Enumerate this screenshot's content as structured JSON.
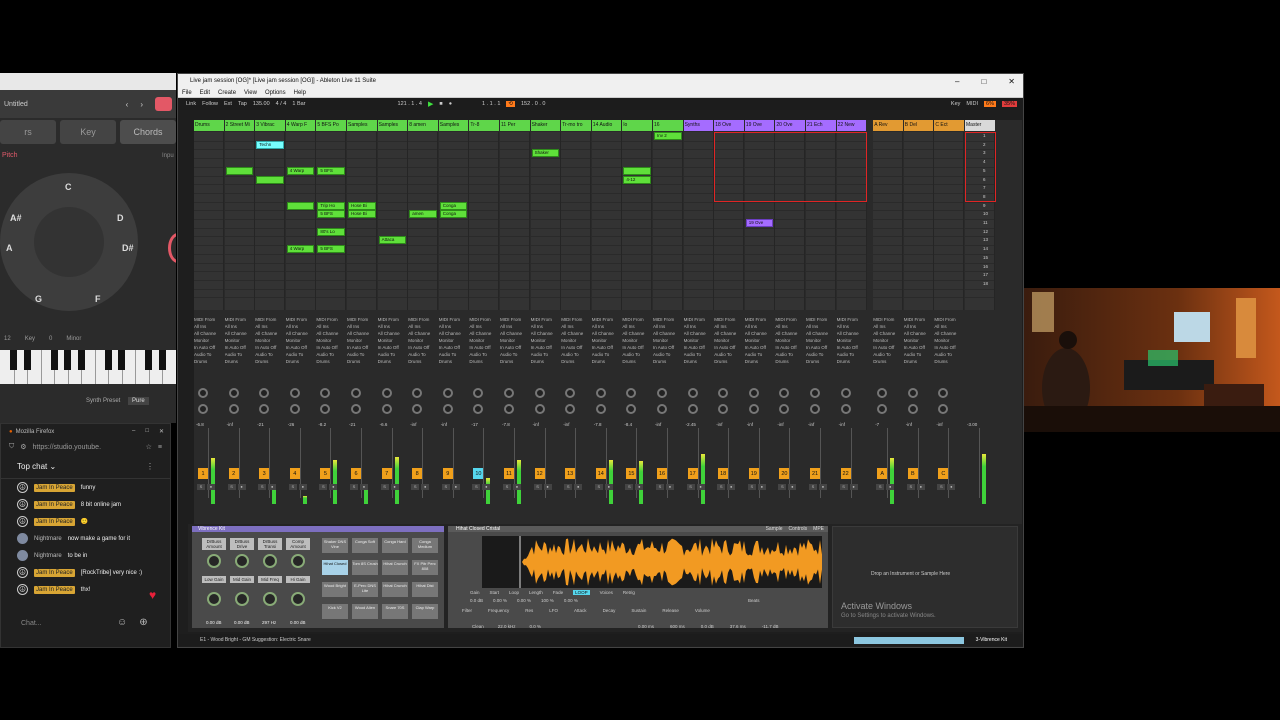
{
  "chord_app": {
    "title": "Untitled",
    "tabs": [
      "rs",
      "Key",
      "Chords"
    ],
    "pitch_label": "Pitch",
    "input_label": "Inpu",
    "wheel_notes": [
      "C",
      "D",
      "D#",
      "F",
      "G",
      "A",
      "A#"
    ],
    "key_row": {
      "num": "12",
      "key_label": "Key",
      "key_value": "0",
      "scale": "Minor"
    },
    "synth_preset_label": "Synth Preset",
    "synth_preset_value": "Pure"
  },
  "firefox": {
    "app_name": "Mozilla Firefox",
    "url": "https://studio.youtube.",
    "chat_mode": "Top chat",
    "messages": [
      {
        "badge": "Jam In Peace",
        "name": "",
        "text": "funny",
        "avatar": "peace"
      },
      {
        "badge": "Jam In Peace",
        "name": "",
        "text": "8 bit online jam",
        "avatar": "peace"
      },
      {
        "badge": "Jam In Peace",
        "name": "",
        "text": "🙂",
        "avatar": "peace"
      },
      {
        "badge": "",
        "name": "Nightmare",
        "text": "now make a game for it",
        "avatar": "img"
      },
      {
        "badge": "",
        "name": "Nightmare",
        "text": "to be in",
        "avatar": "img"
      },
      {
        "badge": "Jam In Peace",
        "name": "",
        "text": "[RockTribe] very nice :)",
        "avatar": "peace"
      },
      {
        "badge": "Jam In Peace",
        "name": "",
        "text": "thx!",
        "avatar": "peace"
      }
    ],
    "chat_placeholder": "Chat..."
  },
  "ableton": {
    "window_title": "Live jam session [OG]* [Live jam session [OG]] - Ableton Live 11 Suite",
    "menu": [
      "File",
      "Edit",
      "Create",
      "View",
      "Options",
      "Help"
    ],
    "control_bar": {
      "link": "Link",
      "follow": "Follow",
      "ext": "Ext",
      "tap": "Tap",
      "tempo": "135.00",
      "signature": "4 / 4",
      "quantize": "1 Bar",
      "position": "121 . 1 . 4",
      "loop_start": "1 . 1 . 1",
      "loop_length": "152 . 0 . 0",
      "key": "Key",
      "midi": "MIDI",
      "cpu_a": "6%",
      "cpu_b": "35%"
    },
    "tracks": [
      {
        "name": "Drums",
        "color": "g"
      },
      {
        "name": "2 Street Mi",
        "color": "g"
      },
      {
        "name": "3 Vibrac",
        "color": "g"
      },
      {
        "name": "4 Warp F",
        "color": "g"
      },
      {
        "name": "5 BFS Po",
        "color": "g"
      },
      {
        "name": "Samples",
        "color": "g"
      },
      {
        "name": "Samples",
        "color": "g"
      },
      {
        "name": "8 amen",
        "color": "g"
      },
      {
        "name": "Samples",
        "color": "g"
      },
      {
        "name": "Tr-8",
        "color": "g"
      },
      {
        "name": "11 Per",
        "color": "g"
      },
      {
        "name": "Shaker",
        "color": "g"
      },
      {
        "name": "Tr-mo tro",
        "color": "g"
      },
      {
        "name": "14 Audio",
        "color": "g"
      },
      {
        "name": "lo",
        "color": "g"
      },
      {
        "name": "16",
        "color": "g"
      },
      {
        "name": "Synths",
        "color": "p"
      },
      {
        "name": "18 Ove",
        "color": "p"
      },
      {
        "name": "19 Ove",
        "color": "p"
      },
      {
        "name": "20 Ove",
        "color": "p"
      },
      {
        "name": "21 Ech",
        "color": "p"
      },
      {
        "name": "22 New",
        "color": "p"
      },
      {
        "name": "A Rev",
        "color": "o"
      },
      {
        "name": "B Del",
        "color": "o"
      },
      {
        "name": "C Ect",
        "color": "o"
      },
      {
        "name": "Master",
        "color": "m"
      }
    ],
    "clips": [
      {
        "col": 2,
        "row": 1,
        "label": "Techn",
        "kind": "cy"
      },
      {
        "col": 11,
        "row": 2,
        "label": "Shaker",
        "kind": "g"
      },
      {
        "col": 1,
        "row": 4,
        "label": "",
        "kind": "g"
      },
      {
        "col": 3,
        "row": 4,
        "label": "4 Warp",
        "kind": "g"
      },
      {
        "col": 4,
        "row": 4,
        "label": "5 BFS",
        "kind": "g"
      },
      {
        "col": 14,
        "row": 4,
        "label": "",
        "kind": "g"
      },
      {
        "col": 2,
        "row": 5,
        "label": "",
        "kind": "g"
      },
      {
        "col": 14,
        "row": 5,
        "label": "4-12",
        "kind": "g"
      },
      {
        "col": 3,
        "row": 8,
        "label": "",
        "kind": "g"
      },
      {
        "col": 4,
        "row": 8,
        "label": "Trip Ho",
        "kind": "g"
      },
      {
        "col": 5,
        "row": 8,
        "label": "Hose Bi",
        "kind": "g"
      },
      {
        "col": 8,
        "row": 8,
        "label": "Conga",
        "kind": "g"
      },
      {
        "col": 4,
        "row": 9,
        "label": "5 BFS",
        "kind": "g"
      },
      {
        "col": 5,
        "row": 9,
        "label": "Hose Bi",
        "kind": "g"
      },
      {
        "col": 7,
        "row": 9,
        "label": "amen",
        "kind": "g"
      },
      {
        "col": 8,
        "row": 9,
        "label": "Conga",
        "kind": "g"
      },
      {
        "col": 18,
        "row": 10,
        "label": "19 Ove",
        "kind": "pu"
      },
      {
        "col": 4,
        "row": 11,
        "label": "80's Lo",
        "kind": "g"
      },
      {
        "col": 6,
        "row": 12,
        "label": "Attaca",
        "kind": "g"
      },
      {
        "col": 3,
        "row": 13,
        "label": "4 Warp",
        "kind": "g"
      },
      {
        "col": 4,
        "row": 13,
        "label": "5 BFS",
        "kind": "g"
      },
      {
        "col": 15,
        "row": 0,
        "label": "Inv 2",
        "kind": "g"
      }
    ],
    "scene_numbers": [
      "1",
      "2",
      "3",
      "4",
      "5",
      "6",
      "7",
      "8",
      "9",
      "10",
      "11",
      "12",
      "13",
      "14",
      "15",
      "16",
      "17",
      "18"
    ],
    "io_labels": [
      "MIDI From",
      "All Ins",
      "All Channe",
      "Monitor",
      "In Auto Off",
      "Audio To",
      "Drums"
    ],
    "volumes": [
      "-6.8",
      "-inf",
      "-21",
      "-26",
      "-8.2",
      "-21",
      "-6.6",
      "-inf",
      "-inf",
      "-17",
      "-7.8",
      "-inf",
      "-inf",
      "-7.8",
      "-8.4",
      "-inf",
      "-2.45",
      "-inf",
      "-inf",
      "-inf",
      "-inf",
      "-inf",
      "-7",
      "-inf",
      "-inf",
      "-3.00"
    ],
    "track_numbers": [
      "1",
      "2",
      "3",
      "4",
      "5",
      "6",
      "7",
      "8",
      "9",
      "10",
      "11",
      "12",
      "13",
      "14",
      "15",
      "16",
      "17",
      "18",
      "19",
      "20",
      "21",
      "22",
      "A",
      "B",
      "C"
    ],
    "device_drum_rack": "Vibrence Kit",
    "macros": [
      "DrBuss Amount",
      "DrBuss Drive",
      "DrBuss Transi",
      "Comp Amount",
      "Low Gain",
      "Mid Gain",
      "Mid Freq",
      "Hi Gain"
    ],
    "macro_values": [
      "0.00 dB",
      "0.00 dB",
      "297 Hz",
      "0.00 dB"
    ],
    "pads": [
      "Shaker DNS Vine",
      "Conga Soft",
      "Conga Hard",
      "Conga Medium",
      "Hihat Closed",
      "Tom 8S Crush",
      "Hihat Crunch",
      "FX Pitr Perc 808",
      "Wood Bright",
      "E-Perc DNS Lite",
      "Hihat Crunch",
      "Hihat Dist",
      "Kick V2",
      "Wood Alien",
      "Snare 70S",
      "Clap Warp"
    ],
    "sample_title": "Hihat Closed Cristal",
    "sample_tabs": [
      "Sample",
      "Controls",
      "MPE"
    ],
    "sample_params": [
      "Gain",
      "Start",
      "Loop",
      "Length",
      "Fade",
      "LOOP",
      "Voices",
      "Retrig"
    ],
    "sample_values": [
      "0.0 dB",
      "0.00 %",
      "0.00 %",
      "100 %",
      "0.00 %"
    ],
    "filter_labels": [
      "Filter",
      "Frequency",
      "Res",
      "Attack",
      "Decay",
      "Sustain",
      "Release",
      "Volume"
    ],
    "filter_values": [
      "0.00 ms",
      "600 ms",
      "0.0 dB",
      "37.6 ms",
      "-11.7 dB"
    ],
    "filter_misc": [
      "Clean",
      "22.0 kHz",
      "0.0 %",
      "LFO",
      "Beats"
    ],
    "drop_zone": "Drop an Instrument or Sample Here",
    "activate_title": "Activate Windows",
    "activate_sub": "Go to Settings to activate Windows.",
    "status_left": "E1 - Wood Bright - GM Suggestion: Electric Snare",
    "status_kit": "3-Vibrence Kit"
  }
}
